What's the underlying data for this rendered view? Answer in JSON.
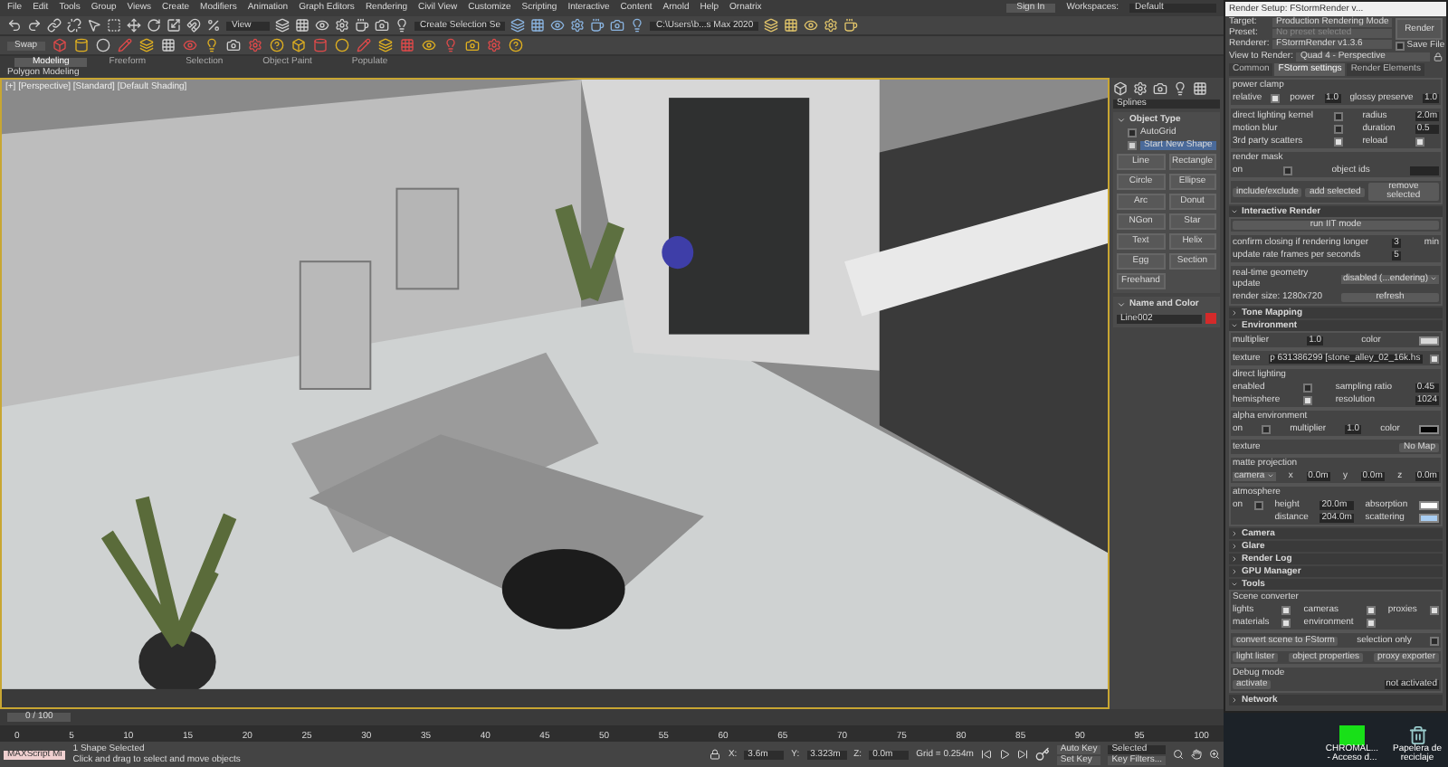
{
  "menu": [
    "File",
    "Edit",
    "Tools",
    "Group",
    "Views",
    "Create",
    "Modifiers",
    "Animation",
    "Graph Editors",
    "Rendering",
    "Civil View",
    "Customize",
    "Scripting",
    "Interactive",
    "Content",
    "Arnold",
    "Help",
    "Ornatrix"
  ],
  "account": {
    "sign_in": "Sign In",
    "workspaces_label": "Workspaces:",
    "workspace": "Default"
  },
  "toolbar": {
    "view_dropdown": "View",
    "selection_set": "Create Selection Se",
    "project_path": "C:\\Users\\b...s Max 2020",
    "swap": "Swap"
  },
  "ribbon_tabs": [
    {
      "label": "Modeling",
      "selected": true
    },
    {
      "label": "Freeform",
      "selected": false
    },
    {
      "label": "Selection",
      "selected": false
    },
    {
      "label": "Object Paint",
      "selected": false
    },
    {
      "label": "Populate",
      "selected": false
    }
  ],
  "ribbon_label": "Polygon Modeling",
  "viewport": {
    "label": "[+] [Perspective] [Standard] [Default Shading]",
    "active": true
  },
  "command_panel": {
    "category": "Splines",
    "object_type": {
      "title": "Object Type",
      "expanded": true,
      "autogrid": {
        "label": "AutoGrid",
        "checked": false
      },
      "start_new_shape": {
        "label": "Start New Shape",
        "checked": true
      },
      "buttons": [
        "Line",
        "Rectangle",
        "Circle",
        "Ellipse",
        "Arc",
        "Donut",
        "NGon",
        "Star",
        "Text",
        "Helix",
        "Egg",
        "Section",
        "Freehand"
      ]
    },
    "name_and_color": {
      "title": "Name and Color",
      "expanded": true,
      "name": "Line002",
      "color": "#d42a2a"
    }
  },
  "render_setup": {
    "title": "Render Setup: FStormRender v...",
    "fields": [
      {
        "label": "Target:",
        "value": "Production Rendering Mode",
        "disabled": false
      },
      {
        "label": "Preset:",
        "value": "No preset selected",
        "disabled": true
      },
      {
        "label": "Renderer:",
        "value": "FStormRender v1.3.6",
        "disabled": false
      }
    ],
    "render_button": "Render",
    "save_file": {
      "label": "Save File",
      "checked": false
    },
    "view_label": "View to Render:",
    "view": "Quad 4 - Perspective",
    "tabs": [
      {
        "label": "Common",
        "selected": false
      },
      {
        "label": "FStorm settings",
        "selected": true
      },
      {
        "label": "Render Elements",
        "selected": false
      }
    ],
    "rollouts": [
      {
        "groups": [
          {
            "title": "power clamp",
            "rows": [
              [
                {
                  "kind": "label",
                  "text": "relative"
                },
                {
                  "kind": "check",
                  "checked": true
                },
                {
                  "kind": "label",
                  "text": "power"
                },
                {
                  "kind": "spin",
                  "value": "1.0"
                },
                {
                  "kind": "label",
                  "text": "glossy preserve"
                },
                {
                  "kind": "spin",
                  "value": "1.0"
                }
              ]
            ]
          },
          {
            "rows": [
              [
                {
                  "kind": "label",
                  "text": "direct lighting kernel"
                },
                {
                  "kind": "check",
                  "checked": false
                },
                {
                  "kind": "label",
                  "text": "radius"
                },
                {
                  "kind": "spin",
                  "value": "2.0m"
                }
              ],
              [
                {
                  "kind": "label",
                  "text": "motion blur"
                },
                {
                  "kind": "check",
                  "checked": false
                },
                {
                  "kind": "label",
                  "text": "duration"
                },
                {
                  "kind": "spin",
                  "value": "0.5"
                }
              ],
              [
                {
                  "kind": "label",
                  "text": "3rd party scatters"
                },
                {
                  "kind": "check",
                  "checked": true
                },
                {
                  "kind": "label",
                  "text": "reload"
                },
                {
                  "kind": "check",
                  "checked": true
                }
              ]
            ]
          },
          {
            "title": "render mask",
            "rows": [
              [
                {
                  "kind": "label",
                  "text": "on"
                },
                {
                  "kind": "check",
                  "checked": false
                },
                {
                  "kind": "label",
                  "text": "object ids"
                },
                {
                  "kind": "field"
                }
              ]
            ]
          },
          {
            "rows": [
              [
                {
                  "kind": "button",
                  "text": "include/exclude"
                },
                {
                  "kind": "button",
                  "text": "add selected"
                },
                {
                  "kind": "button",
                  "text": "remove selected"
                }
              ]
            ]
          }
        ]
      },
      {
        "title": "Interactive Render",
        "expanded": true,
        "groups": [
          {
            "rows": [
              [
                {
                  "kind": "button",
                  "text": "run IIT mode"
                }
              ]
            ]
          },
          {
            "rows": [
              [
                {
                  "kind": "label",
                  "text": "confirm closing if rendering longer"
                },
                {
                  "kind": "spin",
                  "value": "3"
                },
                {
                  "kind": "label",
                  "text": "min"
                }
              ],
              [
                {
                  "kind": "label",
                  "text": "update rate frames per seconds"
                },
                {
                  "kind": "spin",
                  "value": "5"
                }
              ]
            ]
          },
          {
            "rows": [
              [
                {
                  "kind": "label",
                  "text": "real-time geometry update"
                },
                {
                  "kind": "dropdown",
                  "value": "disabled (...endering)"
                }
              ],
              [
                {
                  "kind": "label",
                  "text": "render size: 1280x720"
                },
                {
                  "kind": "button",
                  "text": "refresh"
                }
              ]
            ]
          }
        ]
      },
      {
        "title": "Tone Mapping",
        "expanded": false
      },
      {
        "title": "Environment",
        "expanded": true,
        "groups": [
          {
            "rows": [
              [
                {
                  "kind": "label",
                  "text": "multiplier"
                },
                {
                  "kind": "spin",
                  "value": "1.0"
                },
                {
                  "kind": "label",
                  "text": "color"
                },
                {
                  "kind": "color",
                  "color": "#d8d8d8"
                }
              ]
            ]
          },
          {
            "rows": [
              [
                {
                  "kind": "label",
                  "text": "texture"
                },
                {
                  "kind": "field",
                  "value": "p 631386299 [stone_alley_02_16k.hs"
                },
                {
                  "kind": "check",
                  "checked": true
                }
              ]
            ]
          },
          {
            "title": "direct lighting",
            "rows": [
              [
                {
                  "kind": "label",
                  "text": "enabled"
                },
                {
                  "kind": "check",
                  "checked": false
                },
                {
                  "kind": "label",
                  "text": "sampling ratio"
                },
                {
                  "kind": "spin",
                  "value": "0.45"
                }
              ],
              [
                {
                  "kind": "label",
                  "text": "hemisphere"
                },
                {
                  "kind": "check",
                  "checked": true
                },
                {
                  "kind": "label",
                  "text": "resolution"
                },
                {
                  "kind": "spin",
                  "value": "1024"
                }
              ]
            ]
          },
          {
            "title": "alpha environment",
            "rows": [
              [
                {
                  "kind": "label",
                  "text": "on"
                },
                {
                  "kind": "check",
                  "checked": false
                },
                {
                  "kind": "label",
                  "text": "multiplier"
                },
                {
                  "kind": "spin",
                  "value": "1.0"
                },
                {
                  "kind": "label",
                  "text": "color"
                },
                {
                  "kind": "color",
                  "color": "#050505"
                }
              ]
            ]
          },
          {
            "rows": [
              [
                {
                  "kind": "label",
                  "text": "texture"
                },
                {
                  "kind": "button",
                  "text": "No Map"
                }
              ]
            ]
          },
          {
            "title": "matte projection",
            "rows": [
              [
                {
                  "kind": "dropdown",
                  "value": "camera"
                },
                {
                  "kind": "label",
                  "text": "x"
                },
                {
                  "kind": "spin",
                  "value": "0.0m"
                },
                {
                  "kind": "label",
                  "text": "y"
                },
                {
                  "kind": "spin",
                  "value": "0.0m"
                },
                {
                  "kind": "label",
                  "text": "z"
                },
                {
                  "kind": "spin",
                  "value": "0.0m"
                }
              ]
            ]
          },
          {
            "title": "atmosphere",
            "rows": [
              [
                {
                  "kind": "label",
                  "text": "on"
                },
                {
                  "kind": "check",
                  "checked": false
                },
                {
                  "kind": "label",
                  "text": "height"
                },
                {
                  "kind": "spin",
                  "value": "20.0m"
                },
                {
                  "kind": "label",
                  "text": "absorption"
                },
                {
                  "kind": "color",
                  "color": "#ffffff"
                }
              ],
              [
                {
                  "kind": "gap"
                },
                {
                  "kind": "gap"
                },
                {
                  "kind": "label",
                  "text": "distance"
                },
                {
                  "kind": "spin",
                  "value": "204.0m"
                },
                {
                  "kind": "label",
                  "text": "scattering"
                },
                {
                  "kind": "color",
                  "color": "#a8cdf2"
                }
              ]
            ]
          }
        ]
      },
      {
        "title": "Camera",
        "expanded": false
      },
      {
        "title": "Glare",
        "expanded": false
      },
      {
        "title": "Render Log",
        "expanded": false
      },
      {
        "title": "GPU Manager",
        "expanded": false
      },
      {
        "title": "Tools",
        "expanded": true,
        "groups": [
          {
            "title": "Scene converter",
            "rows": [
              [
                {
                  "kind": "label",
                  "text": "lights"
                },
                {
                  "kind": "check",
                  "checked": true
                },
                {
                  "kind": "label",
                  "text": "cameras"
                },
                {
                  "kind": "check",
                  "checked": true
                },
                {
                  "kind": "label",
                  "text": "proxies"
                },
                {
                  "kind": "check",
                  "checked": true
                }
              ],
              [
                {
                  "kind": "label",
                  "text": "materials"
                },
                {
                  "kind": "check",
                  "checked": true
                },
                {
                  "kind": "label",
                  "text": "environment"
                },
                {
                  "kind": "check",
                  "checked": true
                }
              ]
            ]
          },
          {
            "rows": [
              [
                {
                  "kind": "button",
                  "text": "convert scene to FStorm"
                },
                {
                  "kind": "label",
                  "text": "selection only"
                },
                {
                  "kind": "check",
                  "checked": false
                }
              ]
            ]
          },
          {
            "rows": [
              [
                {
                  "kind": "button",
                  "text": "light lister"
                },
                {
                  "kind": "button",
                  "text": "object properties"
                },
                {
                  "kind": "button",
                  "text": "proxy exporter"
                }
              ]
            ]
          },
          {
            "title": "Debug mode",
            "rows": [
              [
                {
                  "kind": "button",
                  "text": "activate"
                },
                {
                  "kind": "field",
                  "value": "not activated"
                }
              ]
            ]
          }
        ]
      },
      {
        "title": "Network",
        "expanded": false
      }
    ]
  },
  "desktop": [
    {
      "kind": "app",
      "label": "CHROMAL... - Acceso d..."
    },
    {
      "kind": "bin",
      "label": "Papelera de reciclaje"
    }
  ],
  "timeline": {
    "slider": "0 / 100",
    "level": 0,
    "ticks": [
      "0",
      "5",
      "10",
      "15",
      "20",
      "25",
      "30",
      "35",
      "40",
      "45",
      "50",
      "55",
      "60",
      "65",
      "70",
      "75",
      "80",
      "85",
      "90",
      "95",
      "100"
    ]
  },
  "status": {
    "maxscript": "MAXScript Mi",
    "selection": "1 Shape Selected",
    "prompt": "Click and drag to select and move objects",
    "coords": [
      {
        "axis": "X:",
        "value": "3.6m"
      },
      {
        "axis": "Y:",
        "value": "3.323m"
      },
      {
        "axis": "Z:",
        "value": "0.0m"
      }
    ],
    "grid": "Grid = 0.254m",
    "auto_key": "Auto Key",
    "set_key": "Set Key",
    "key_mode": "Selected",
    "key_filters": "Key Filters..."
  }
}
